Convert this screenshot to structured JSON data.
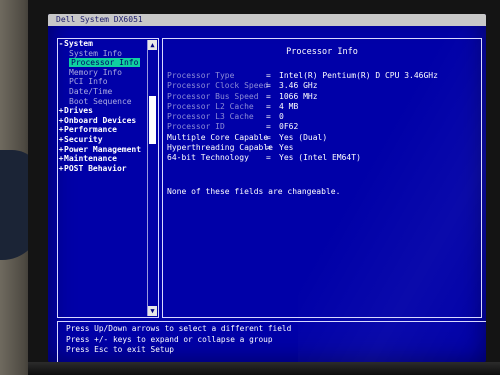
{
  "bios": {
    "title": "Dell System DX6051",
    "nav": {
      "groups": [
        {
          "label": "System",
          "expander": "-"
        },
        {
          "label": "Drives",
          "expander": "+"
        },
        {
          "label": "Onboard Devices",
          "expander": "+"
        },
        {
          "label": "Performance",
          "expander": "+"
        },
        {
          "label": "Security",
          "expander": "+"
        },
        {
          "label": "Power Management",
          "expander": "+"
        },
        {
          "label": "Maintenance",
          "expander": "+"
        },
        {
          "label": "POST Behavior",
          "expander": "+"
        }
      ],
      "system_items": [
        {
          "label": "System Info"
        },
        {
          "label": "Processor Info"
        },
        {
          "label": "Memory Info"
        },
        {
          "label": "PCI Info"
        },
        {
          "label": "Date/Time"
        },
        {
          "label": "Boot Sequence"
        }
      ],
      "selected": "Processor Info",
      "scroll_up": "▲",
      "scroll_down": "▼"
    },
    "detail": {
      "title": "Processor Info",
      "rows": [
        {
          "label": "Processor Type",
          "value": "Intel(R) Pentium(R) D CPU 3.46GHz"
        },
        {
          "label": "Processor Clock Speed",
          "value": "3.46 GHz"
        },
        {
          "label": "Processor Bus Speed",
          "value": "1066 MHz"
        },
        {
          "label": "Processor L2 Cache",
          "value": "4 MB"
        },
        {
          "label": "Processor L3 Cache",
          "value": "0"
        },
        {
          "label": "Processor ID",
          "value": "0F62"
        },
        {
          "label": "Multiple Core Capable",
          "value": "Yes (Dual)"
        },
        {
          "label": "Hyperthreading Capable",
          "value": "Yes"
        },
        {
          "label": "64-bit Technology",
          "value": "Yes (Intel EM64T)"
        }
      ],
      "equals": "=",
      "note": "None of these fields are changeable."
    },
    "help": [
      "Press Up/Down arrows to select a different field",
      "Press +/- keys to expand or collapse a group",
      "Press Esc to exit Setup"
    ],
    "colors": {
      "background": "#0000a8",
      "selection": "#0fd0a0",
      "text": "#ffffff",
      "dim_text": "#8c8cd6"
    }
  }
}
